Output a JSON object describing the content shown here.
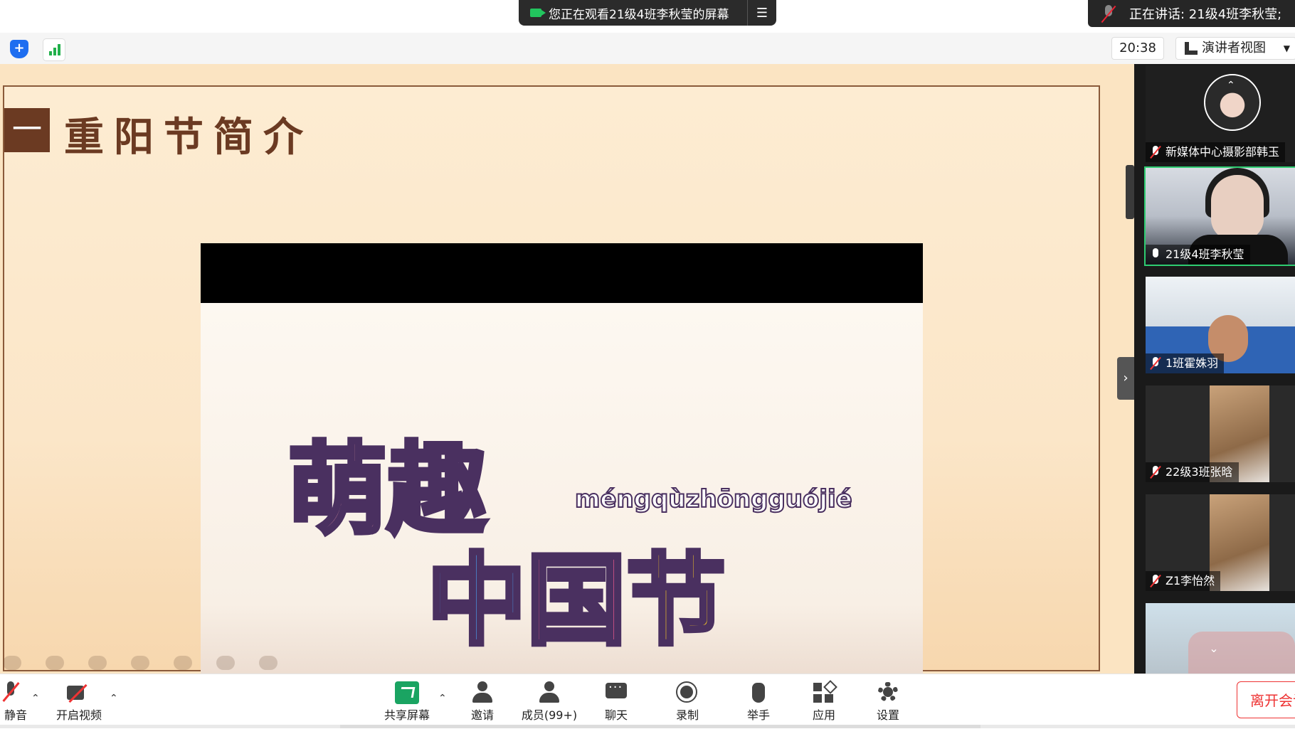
{
  "banner": {
    "text": "您正在观看21级4班李秋莹的屏幕",
    "menu_icon": "list-icon"
  },
  "speaking": {
    "text": "正在讲话: 21级4班李秋莹;"
  },
  "toolbar": {
    "time": "20:38",
    "view_label": "演讲者视图"
  },
  "slide": {
    "number": "一",
    "title": "重阳节简介",
    "video_logo": {
      "line1_char1": "萌",
      "line1_char2": "趣",
      "pinyin": "méngqùzhōngguójié",
      "line2_char1": "中",
      "line2_char2": "国",
      "line2_char3": "节"
    }
  },
  "participants": [
    {
      "name": "新媒体中心摄影部韩玉",
      "muted": true
    },
    {
      "name": "21级4班李秋莹",
      "muted": false,
      "active": true
    },
    {
      "name": "1班霍姝羽",
      "muted": true
    },
    {
      "name": "22级3班张晗",
      "muted": true
    },
    {
      "name": "Z1李怡然",
      "muted": true
    },
    {
      "name": "",
      "muted": true
    }
  ],
  "controls": {
    "mute": "静音",
    "video": "开启视频",
    "share": "共享屏幕",
    "invite": "邀请",
    "members": "成员(99+)",
    "chat": "聊天",
    "record": "录制",
    "raise_hand": "举手",
    "apps": "应用",
    "settings": "设置",
    "leave": "离开会议"
  },
  "colors": {
    "accent_green": "#1aa462",
    "leave_red": "#e33333",
    "slide_brown": "#6b3a22"
  }
}
